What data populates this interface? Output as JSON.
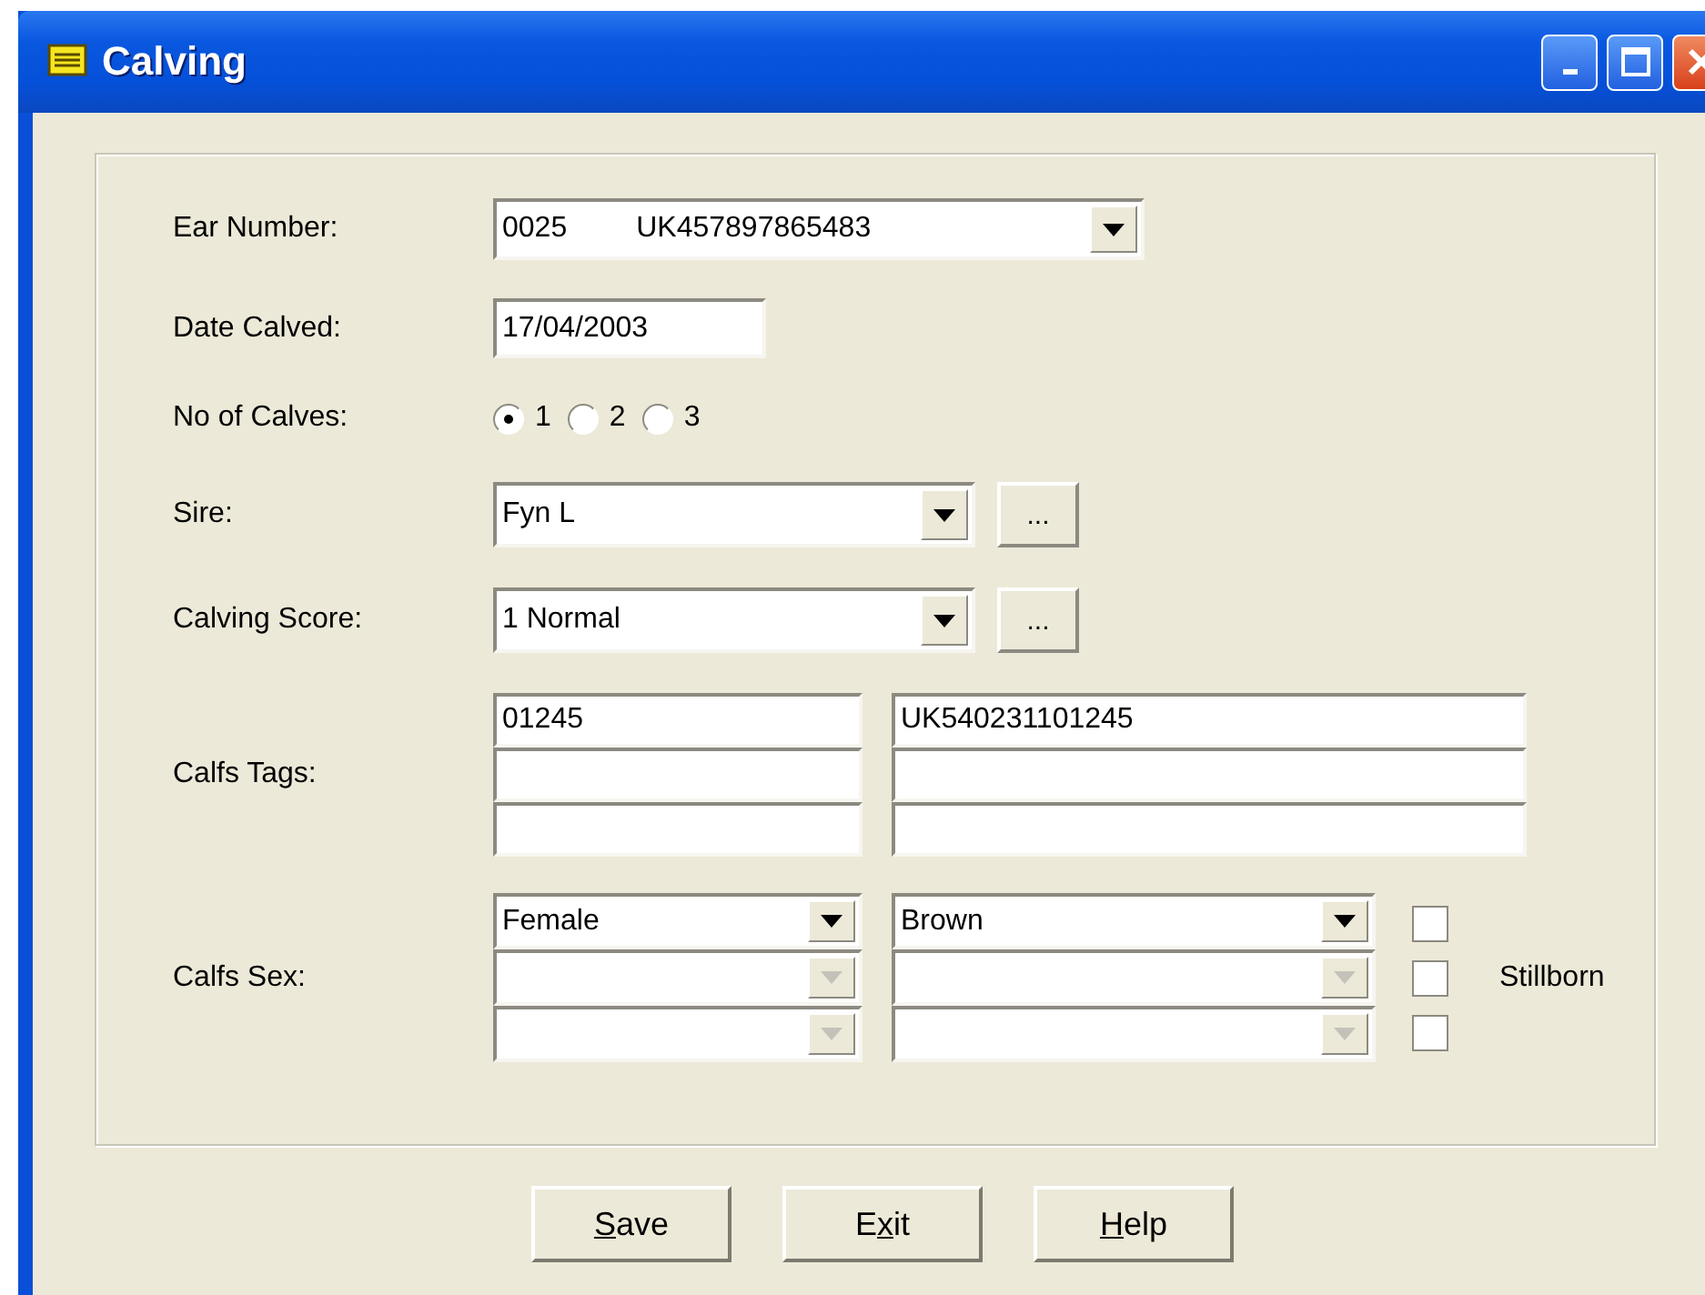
{
  "window": {
    "title": "Calving"
  },
  "form": {
    "ear_number": {
      "label": "Ear Number:",
      "values": [
        "0025",
        "UK457897865483"
      ]
    },
    "date_calved": {
      "label": "Date Calved:",
      "value": "17/04/2003"
    },
    "no_of_calves": {
      "label": "No of Calves:",
      "options": [
        {
          "label": "1",
          "selected": true
        },
        {
          "label": "2",
          "selected": false
        },
        {
          "label": "3",
          "selected": false
        }
      ]
    },
    "sire": {
      "label": "Sire:",
      "value": "Fyn L",
      "browse": "..."
    },
    "calving_score": {
      "label": "Calving Score:",
      "value": "1 Normal",
      "browse": "..."
    },
    "calfs_tags": {
      "label": "Calfs Tags:",
      "rows": [
        {
          "kind": "filled",
          "tag": "01245",
          "official": "UK540231101245"
        },
        {
          "kind": "blank"
        },
        {
          "kind": "blank"
        }
      ]
    },
    "calfs_sex": {
      "label": "Calfs Sex:",
      "stillborn_label": "Stillborn",
      "rows": [
        {
          "sex": "Female",
          "colour": "Brown",
          "disabled": false,
          "stillborn": false
        },
        {
          "disabled": true,
          "stillborn": false
        },
        {
          "disabled": true,
          "stillborn": false
        }
      ]
    }
  },
  "buttons": [
    {
      "key": "S",
      "after": "ave"
    },
    {
      "before": "E",
      "key": "x",
      "after": "it"
    },
    {
      "key": "H",
      "after": "elp"
    }
  ]
}
